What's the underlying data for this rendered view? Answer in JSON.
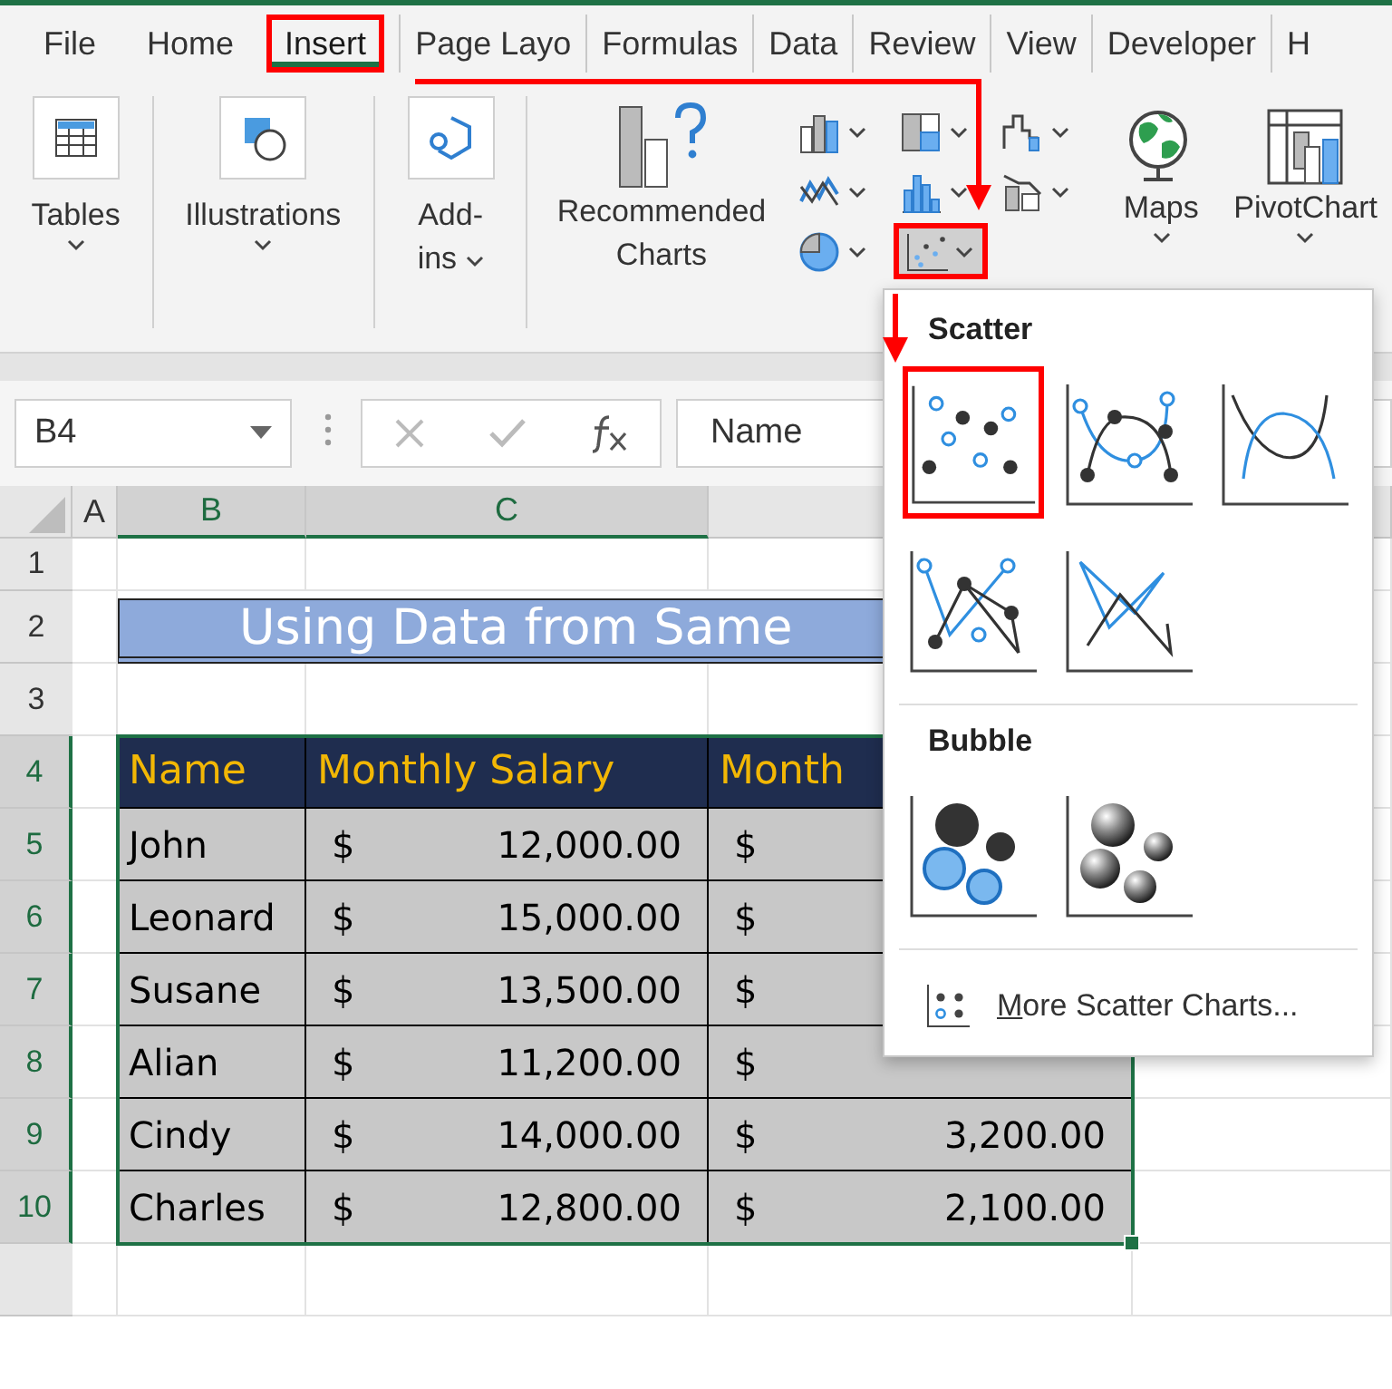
{
  "tabs": [
    {
      "label": "File",
      "selected": false,
      "highlighted": false
    },
    {
      "label": "Home",
      "selected": false,
      "highlighted": false
    },
    {
      "label": "Insert",
      "selected": true,
      "highlighted": true
    },
    {
      "label": "Page Layo",
      "selected": false,
      "highlighted": false
    },
    {
      "label": "Formulas",
      "selected": false,
      "highlighted": false
    },
    {
      "label": "Data",
      "selected": false,
      "highlighted": false
    },
    {
      "label": "Review",
      "selected": false,
      "highlighted": false
    },
    {
      "label": "View",
      "selected": false,
      "highlighted": false
    },
    {
      "label": "Developer",
      "selected": false,
      "highlighted": false
    },
    {
      "label": "H",
      "selected": false,
      "highlighted": false
    }
  ],
  "ribbon": {
    "groups": [
      {
        "kind": "tables",
        "lines": [
          "Tables"
        ]
      },
      {
        "kind": "illustrations",
        "lines": [
          "Illustrations"
        ]
      },
      {
        "kind": "addins",
        "lines": [
          "Add-",
          "ins"
        ]
      }
    ],
    "recommended": {
      "lines": [
        "Recommended",
        "Charts"
      ]
    },
    "chart_buttons": [
      {
        "kind": "column",
        "selected": false,
        "highlighted": false
      },
      {
        "kind": "hierarchy",
        "selected": false,
        "highlighted": false
      },
      {
        "kind": "waterfall",
        "selected": false,
        "highlighted": false
      },
      {
        "kind": "line",
        "selected": false,
        "highlighted": false
      },
      {
        "kind": "statistic",
        "selected": false,
        "highlighted": false
      },
      {
        "kind": "combo",
        "selected": false,
        "highlighted": false
      },
      {
        "kind": "pie",
        "selected": false,
        "highlighted": false
      },
      {
        "kind": "scatter",
        "selected": true,
        "highlighted": true
      }
    ],
    "tail": [
      {
        "kind": "maps",
        "label": "Maps"
      },
      {
        "kind": "pivotchart",
        "label": "PivotChart"
      }
    ]
  },
  "formula_bar": {
    "name_box": "B4",
    "value": "Name"
  },
  "sheet": {
    "columns": [
      "A",
      "B",
      "C"
    ],
    "rows": [
      "1",
      "2",
      "3",
      "4",
      "5",
      "6",
      "7",
      "8",
      "9",
      "10"
    ],
    "title": "Using Data from Same",
    "table": {
      "headers": [
        "Name",
        "Monthly Salary",
        "Month"
      ],
      "rows": [
        {
          "name": "John",
          "salary": {
            "symbol": "$",
            "amount": "12,000.00"
          },
          "column_3": {
            "symbol": "$"
          }
        },
        {
          "name": "Leonard",
          "salary": {
            "symbol": "$",
            "amount": "15,000.00"
          },
          "column_3": {
            "symbol": "$"
          }
        },
        {
          "name": "Susane",
          "salary": {
            "symbol": "$",
            "amount": "13,500.00"
          },
          "column_3": {
            "symbol": "$"
          }
        },
        {
          "name": "Alian",
          "salary": {
            "symbol": "$",
            "amount": "11,200.00"
          },
          "column_3": {
            "symbol": "$"
          }
        },
        {
          "name": "Cindy",
          "salary": {
            "symbol": "$",
            "amount": "14,000.00"
          },
          "column_3": {
            "symbol": "$",
            "amount": "3,200.00"
          }
        },
        {
          "name": "Charles",
          "salary": {
            "symbol": "$",
            "amount": "12,800.00"
          },
          "column_3": {
            "symbol": "$",
            "amount": "2,100.00"
          }
        }
      ]
    }
  },
  "dropdown": {
    "sections": [
      {
        "title": "Scatter",
        "options": [
          {
            "kind": "scatter",
            "highlighted": true
          },
          {
            "kind": "smooth-markers",
            "highlighted": false
          },
          {
            "kind": "smooth",
            "highlighted": false
          },
          {
            "kind": "lines-markers",
            "highlighted": false
          },
          {
            "kind": "lines",
            "highlighted": false
          }
        ]
      },
      {
        "title": "Bubble",
        "options": [
          {
            "kind": "bubble",
            "highlighted": false
          },
          {
            "kind": "bubble-3d",
            "highlighted": false
          }
        ]
      }
    ],
    "more": "More Scatter Charts..."
  }
}
